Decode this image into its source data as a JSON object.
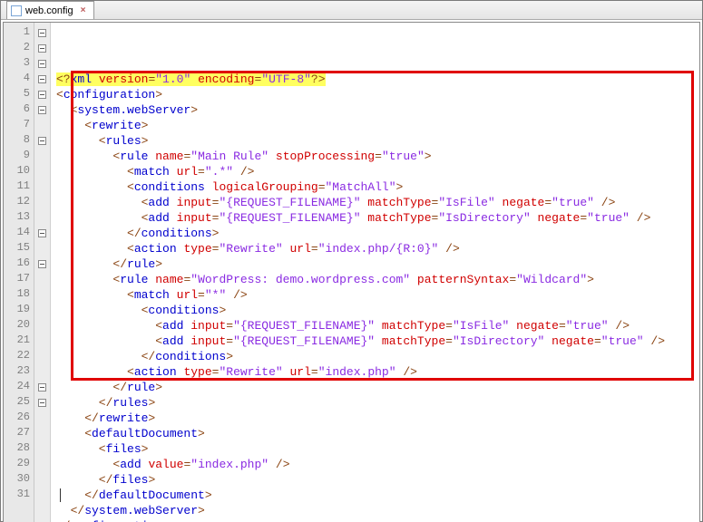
{
  "tab": {
    "filename": "web.config",
    "close_glyph": "×"
  },
  "colors": {
    "highlight": "#e00000",
    "xml_declare_bg": "#ffff60"
  },
  "lines": [
    {
      "n": 1,
      "fold": "minus",
      "tokens": [
        {
          "t": "<?",
          "cls": "t-brown hl-yellow"
        },
        {
          "t": "xml ",
          "cls": "t-blue hl-yellow"
        },
        {
          "t": "version",
          "cls": "t-red hl-yellow"
        },
        {
          "t": "=",
          "cls": "t-oper hl-yellow"
        },
        {
          "t": "\"1.0\"",
          "cls": "t-purple hl-yellow"
        },
        {
          "t": " ",
          "cls": "hl-yellow"
        },
        {
          "t": "encoding",
          "cls": "t-red hl-yellow"
        },
        {
          "t": "=",
          "cls": "t-oper hl-yellow"
        },
        {
          "t": "\"UTF-8\"",
          "cls": "t-purple hl-yellow"
        },
        {
          "t": "?>",
          "cls": "t-brown hl-yellow"
        }
      ]
    },
    {
      "n": 2,
      "fold": "minus",
      "tokens": [
        {
          "t": "<",
          "cls": "t-brown"
        },
        {
          "t": "configuration",
          "cls": "t-blue"
        },
        {
          "t": ">",
          "cls": "t-brown"
        }
      ]
    },
    {
      "n": 3,
      "fold": "minus",
      "tokens": [
        {
          "t": "  <",
          "cls": "t-brown"
        },
        {
          "t": "system.webServer",
          "cls": "t-blue"
        },
        {
          "t": ">",
          "cls": "t-brown"
        }
      ]
    },
    {
      "n": 4,
      "fold": "minus",
      "tokens": [
        {
          "t": "    <",
          "cls": "t-brown"
        },
        {
          "t": "rewrite",
          "cls": "t-blue"
        },
        {
          "t": ">",
          "cls": "t-brown"
        }
      ]
    },
    {
      "n": 5,
      "fold": "minus",
      "tokens": [
        {
          "t": "      <",
          "cls": "t-brown"
        },
        {
          "t": "rules",
          "cls": "t-blue"
        },
        {
          "t": ">",
          "cls": "t-brown"
        }
      ]
    },
    {
      "n": 6,
      "fold": "minus",
      "tokens": [
        {
          "t": "        <",
          "cls": "t-brown"
        },
        {
          "t": "rule ",
          "cls": "t-blue"
        },
        {
          "t": "name",
          "cls": "t-red"
        },
        {
          "t": "=",
          "cls": "t-oper"
        },
        {
          "t": "\"Main Rule\"",
          "cls": "t-purple"
        },
        {
          "t": " stopProcessing",
          "cls": "t-red"
        },
        {
          "t": "=",
          "cls": "t-oper"
        },
        {
          "t": "\"true\"",
          "cls": "t-purple"
        },
        {
          "t": ">",
          "cls": "t-brown"
        }
      ]
    },
    {
      "n": 7,
      "fold": "",
      "tokens": [
        {
          "t": "          <",
          "cls": "t-brown"
        },
        {
          "t": "match ",
          "cls": "t-blue"
        },
        {
          "t": "url",
          "cls": "t-red"
        },
        {
          "t": "=",
          "cls": "t-oper"
        },
        {
          "t": "\".*\"",
          "cls": "t-purple"
        },
        {
          "t": " />",
          "cls": "t-brown"
        }
      ]
    },
    {
      "n": 8,
      "fold": "minus",
      "tokens": [
        {
          "t": "          <",
          "cls": "t-brown"
        },
        {
          "t": "conditions ",
          "cls": "t-blue"
        },
        {
          "t": "logicalGrouping",
          "cls": "t-red"
        },
        {
          "t": "=",
          "cls": "t-oper"
        },
        {
          "t": "\"MatchAll\"",
          "cls": "t-purple"
        },
        {
          "t": ">",
          "cls": "t-brown"
        }
      ]
    },
    {
      "n": 9,
      "fold": "",
      "tokens": [
        {
          "t": "            <",
          "cls": "t-brown"
        },
        {
          "t": "add ",
          "cls": "t-blue"
        },
        {
          "t": "input",
          "cls": "t-red"
        },
        {
          "t": "=",
          "cls": "t-oper"
        },
        {
          "t": "\"{REQUEST_FILENAME}\"",
          "cls": "t-purple"
        },
        {
          "t": " matchType",
          "cls": "t-red"
        },
        {
          "t": "=",
          "cls": "t-oper"
        },
        {
          "t": "\"IsFile\"",
          "cls": "t-purple"
        },
        {
          "t": " negate",
          "cls": "t-red"
        },
        {
          "t": "=",
          "cls": "t-oper"
        },
        {
          "t": "\"true\"",
          "cls": "t-purple"
        },
        {
          "t": " />",
          "cls": "t-brown"
        }
      ]
    },
    {
      "n": 10,
      "fold": "",
      "tokens": [
        {
          "t": "            <",
          "cls": "t-brown"
        },
        {
          "t": "add ",
          "cls": "t-blue"
        },
        {
          "t": "input",
          "cls": "t-red"
        },
        {
          "t": "=",
          "cls": "t-oper"
        },
        {
          "t": "\"{REQUEST_FILENAME}\"",
          "cls": "t-purple"
        },
        {
          "t": " matchType",
          "cls": "t-red"
        },
        {
          "t": "=",
          "cls": "t-oper"
        },
        {
          "t": "\"IsDirectory\"",
          "cls": "t-purple"
        },
        {
          "t": " negate",
          "cls": "t-red"
        },
        {
          "t": "=",
          "cls": "t-oper"
        },
        {
          "t": "\"true\"",
          "cls": "t-purple"
        },
        {
          "t": " />",
          "cls": "t-brown"
        }
      ]
    },
    {
      "n": 11,
      "fold": "",
      "tokens": [
        {
          "t": "          </",
          "cls": "t-brown"
        },
        {
          "t": "conditions",
          "cls": "t-blue"
        },
        {
          "t": ">",
          "cls": "t-brown"
        }
      ]
    },
    {
      "n": 12,
      "fold": "",
      "tokens": [
        {
          "t": "          <",
          "cls": "t-brown"
        },
        {
          "t": "action ",
          "cls": "t-blue"
        },
        {
          "t": "type",
          "cls": "t-red"
        },
        {
          "t": "=",
          "cls": "t-oper"
        },
        {
          "t": "\"Rewrite\"",
          "cls": "t-purple"
        },
        {
          "t": " url",
          "cls": "t-red"
        },
        {
          "t": "=",
          "cls": "t-oper"
        },
        {
          "t": "\"index.php/{R:0}\"",
          "cls": "t-purple"
        },
        {
          "t": " />",
          "cls": "t-brown"
        }
      ]
    },
    {
      "n": 13,
      "fold": "",
      "tokens": [
        {
          "t": "        </",
          "cls": "t-brown"
        },
        {
          "t": "rule",
          "cls": "t-blue"
        },
        {
          "t": ">",
          "cls": "t-brown"
        }
      ]
    },
    {
      "n": 14,
      "fold": "minus",
      "tokens": [
        {
          "t": "        <",
          "cls": "t-brown"
        },
        {
          "t": "rule ",
          "cls": "t-blue"
        },
        {
          "t": "name",
          "cls": "t-red"
        },
        {
          "t": "=",
          "cls": "t-oper"
        },
        {
          "t": "\"WordPress: demo.wordpress.com\"",
          "cls": "t-purple"
        },
        {
          "t": " patternSyntax",
          "cls": "t-red"
        },
        {
          "t": "=",
          "cls": "t-oper"
        },
        {
          "t": "\"Wildcard\"",
          "cls": "t-purple"
        },
        {
          "t": ">",
          "cls": "t-brown"
        }
      ]
    },
    {
      "n": 15,
      "fold": "",
      "tokens": [
        {
          "t": "          <",
          "cls": "t-brown"
        },
        {
          "t": "match ",
          "cls": "t-blue"
        },
        {
          "t": "url",
          "cls": "t-red"
        },
        {
          "t": "=",
          "cls": "t-oper"
        },
        {
          "t": "\"*\"",
          "cls": "t-purple"
        },
        {
          "t": " />",
          "cls": "t-brown"
        }
      ]
    },
    {
      "n": 16,
      "fold": "minus",
      "tokens": [
        {
          "t": "            <",
          "cls": "t-brown"
        },
        {
          "t": "conditions",
          "cls": "t-blue"
        },
        {
          "t": ">",
          "cls": "t-brown"
        }
      ]
    },
    {
      "n": 17,
      "fold": "",
      "tokens": [
        {
          "t": "              <",
          "cls": "t-brown"
        },
        {
          "t": "add ",
          "cls": "t-blue"
        },
        {
          "t": "input",
          "cls": "t-red"
        },
        {
          "t": "=",
          "cls": "t-oper"
        },
        {
          "t": "\"{REQUEST_FILENAME}\"",
          "cls": "t-purple"
        },
        {
          "t": " matchType",
          "cls": "t-red"
        },
        {
          "t": "=",
          "cls": "t-oper"
        },
        {
          "t": "\"IsFile\"",
          "cls": "t-purple"
        },
        {
          "t": " negate",
          "cls": "t-red"
        },
        {
          "t": "=",
          "cls": "t-oper"
        },
        {
          "t": "\"true\"",
          "cls": "t-purple"
        },
        {
          "t": " />",
          "cls": "t-brown"
        }
      ]
    },
    {
      "n": 18,
      "fold": "",
      "tokens": [
        {
          "t": "              <",
          "cls": "t-brown"
        },
        {
          "t": "add ",
          "cls": "t-blue"
        },
        {
          "t": "input",
          "cls": "t-red"
        },
        {
          "t": "=",
          "cls": "t-oper"
        },
        {
          "t": "\"{REQUEST_FILENAME}\"",
          "cls": "t-purple"
        },
        {
          "t": " matchType",
          "cls": "t-red"
        },
        {
          "t": "=",
          "cls": "t-oper"
        },
        {
          "t": "\"IsDirectory\"",
          "cls": "t-purple"
        },
        {
          "t": " negate",
          "cls": "t-red"
        },
        {
          "t": "=",
          "cls": "t-oper"
        },
        {
          "t": "\"true\"",
          "cls": "t-purple"
        },
        {
          "t": " />",
          "cls": "t-brown"
        }
      ]
    },
    {
      "n": 19,
      "fold": "",
      "tokens": [
        {
          "t": "            </",
          "cls": "t-brown"
        },
        {
          "t": "conditions",
          "cls": "t-blue"
        },
        {
          "t": ">",
          "cls": "t-brown"
        }
      ]
    },
    {
      "n": 20,
      "fold": "",
      "tokens": [
        {
          "t": "          <",
          "cls": "t-brown"
        },
        {
          "t": "action ",
          "cls": "t-blue"
        },
        {
          "t": "type",
          "cls": "t-red"
        },
        {
          "t": "=",
          "cls": "t-oper"
        },
        {
          "t": "\"Rewrite\"",
          "cls": "t-purple"
        },
        {
          "t": " url",
          "cls": "t-red"
        },
        {
          "t": "=",
          "cls": "t-oper"
        },
        {
          "t": "\"index.php\"",
          "cls": "t-purple"
        },
        {
          "t": " />",
          "cls": "t-brown"
        }
      ]
    },
    {
      "n": 21,
      "fold": "",
      "tokens": [
        {
          "t": "        </",
          "cls": "t-brown"
        },
        {
          "t": "rule",
          "cls": "t-blue"
        },
        {
          "t": ">",
          "cls": "t-brown"
        }
      ]
    },
    {
      "n": 22,
      "fold": "",
      "tokens": [
        {
          "t": "      </",
          "cls": "t-brown"
        },
        {
          "t": "rules",
          "cls": "t-blue"
        },
        {
          "t": ">",
          "cls": "t-brown"
        }
      ]
    },
    {
      "n": 23,
      "fold": "",
      "tokens": [
        {
          "t": "    </",
          "cls": "t-brown"
        },
        {
          "t": "rewrite",
          "cls": "t-blue"
        },
        {
          "t": ">",
          "cls": "t-brown"
        }
      ]
    },
    {
      "n": 24,
      "fold": "minus",
      "tokens": [
        {
          "t": "    <",
          "cls": "t-brown"
        },
        {
          "t": "defaultDocument",
          "cls": "t-blue"
        },
        {
          "t": ">",
          "cls": "t-brown"
        }
      ]
    },
    {
      "n": 25,
      "fold": "minus",
      "tokens": [
        {
          "t": "      <",
          "cls": "t-brown"
        },
        {
          "t": "files",
          "cls": "t-blue"
        },
        {
          "t": ">",
          "cls": "t-brown"
        }
      ]
    },
    {
      "n": 26,
      "fold": "",
      "tokens": [
        {
          "t": "        <",
          "cls": "t-brown"
        },
        {
          "t": "add ",
          "cls": "t-blue"
        },
        {
          "t": "value",
          "cls": "t-red"
        },
        {
          "t": "=",
          "cls": "t-oper"
        },
        {
          "t": "\"index.php\"",
          "cls": "t-purple"
        },
        {
          "t": " />",
          "cls": "t-brown"
        }
      ]
    },
    {
      "n": 27,
      "fold": "",
      "tokens": [
        {
          "t": "      </",
          "cls": "t-brown"
        },
        {
          "t": "files",
          "cls": "t-blue"
        },
        {
          "t": ">",
          "cls": "t-brown"
        }
      ]
    },
    {
      "n": 28,
      "fold": "",
      "tokens": [
        {
          "t": "    </",
          "cls": "t-brown"
        },
        {
          "t": "defaultDocument",
          "cls": "t-blue"
        },
        {
          "t": ">",
          "cls": "t-brown"
        }
      ]
    },
    {
      "n": 29,
      "fold": "",
      "tokens": [
        {
          "t": "  </",
          "cls": "t-brown"
        },
        {
          "t": "system.webServer",
          "cls": "t-blue"
        },
        {
          "t": ">",
          "cls": "t-brown"
        }
      ]
    },
    {
      "n": 30,
      "fold": "",
      "tokens": [
        {
          "t": "</",
          "cls": "t-brown"
        },
        {
          "t": "configuration",
          "cls": "t-blue"
        },
        {
          "t": ">",
          "cls": "t-brown"
        }
      ]
    },
    {
      "n": 31,
      "fold": "",
      "tokens": []
    }
  ],
  "highlight_box": {
    "top_line": 4,
    "bottom_line": 23
  },
  "cursor_line": 31
}
